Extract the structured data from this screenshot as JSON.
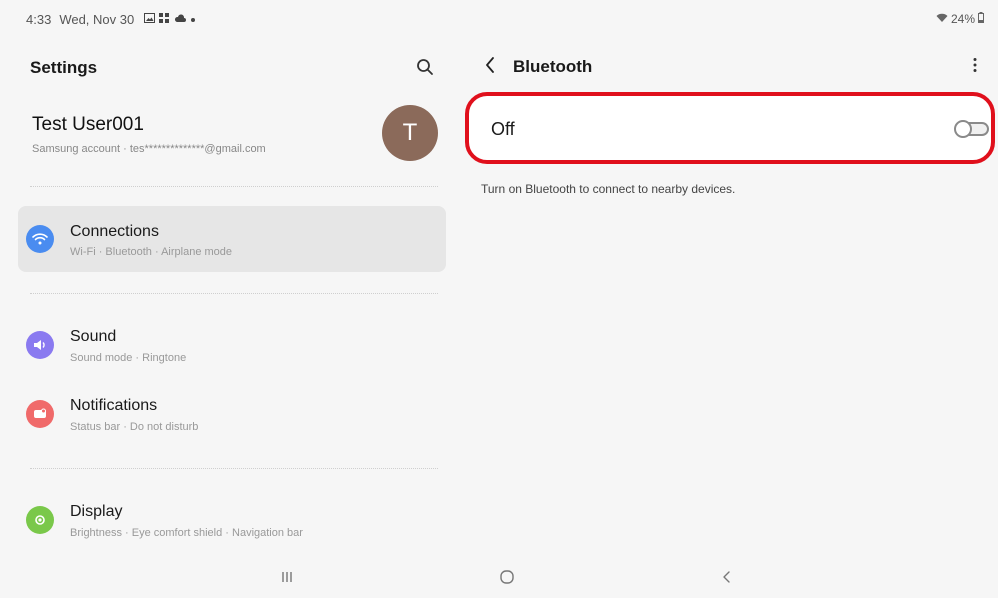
{
  "status_bar": {
    "time": "4:33",
    "date": "Wed, Nov 30",
    "battery": "24%"
  },
  "left": {
    "title": "Settings",
    "account": {
      "name": "Test User001",
      "subtitle": "Samsung account · tes**************@gmail.com",
      "avatar_letter": "T",
      "avatar_color": "#8b6a5a"
    },
    "items": [
      {
        "label": "Connections",
        "sub": "Wi-Fi · Bluetooth · Airplane mode",
        "icon": "wifi-icon",
        "color": "#4a8cf0",
        "selected": true
      },
      {
        "label": "Sound",
        "sub": "Sound mode · Ringtone",
        "icon": "speaker-icon",
        "color": "#8a7af0",
        "selected": false
      },
      {
        "label": "Notifications",
        "sub": "Status bar · Do not disturb",
        "icon": "notification-icon",
        "color": "#f06a6a",
        "selected": false
      },
      {
        "label": "Display",
        "sub": "Brightness · Eye comfort shield · Navigation bar",
        "icon": "display-icon",
        "color": "#7ac84a",
        "selected": false
      }
    ]
  },
  "right": {
    "title": "Bluetooth",
    "toggle_label": "Off",
    "toggle_on": false,
    "hint": "Turn on Bluetooth to connect to nearby devices.",
    "highlight_color": "#e0101c"
  }
}
